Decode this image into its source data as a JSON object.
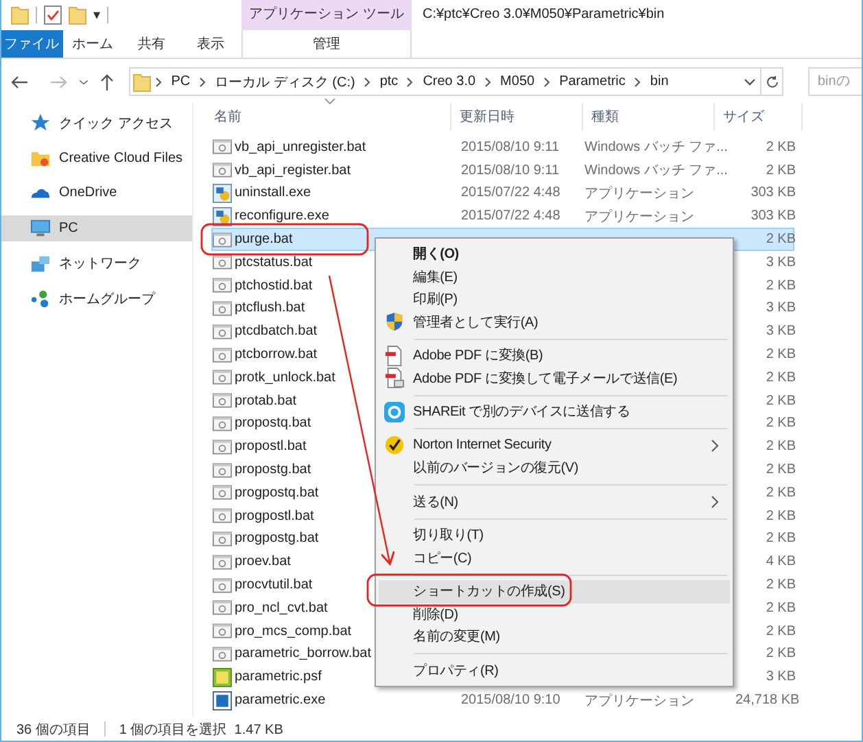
{
  "quick_toolbar": {
    "dropdown": "▾"
  },
  "title_bar": {
    "context_label": "アプリケーション ツール",
    "path": "C:¥ptc¥Creo 3.0¥M050¥Parametric¥bin"
  },
  "ribbon_tabs": [
    {
      "label": "ファイル",
      "kind": "file"
    },
    {
      "label": "ホーム",
      "kind": "normal"
    },
    {
      "label": "共有",
      "kind": "normal"
    },
    {
      "label": "表示",
      "kind": "normal"
    },
    {
      "label": "管理",
      "kind": "context"
    }
  ],
  "address_bar": {
    "crumbs": [
      "PC",
      "ローカル ディスク (C:)",
      "ptc",
      "Creo 3.0",
      "M050",
      "Parametric",
      "bin"
    ]
  },
  "search": {
    "placeholder": "binの"
  },
  "sidebar": {
    "items": [
      {
        "label": "クイック アクセス",
        "kind": "star",
        "selected": false
      },
      {
        "label": "Creative Cloud Files",
        "kind": "cloudfolder",
        "selected": false
      },
      {
        "label": "OneDrive",
        "kind": "cloud",
        "selected": false
      },
      {
        "label": "PC",
        "kind": "computer",
        "selected": true
      },
      {
        "label": "ネットワーク",
        "kind": "network",
        "selected": false
      },
      {
        "label": "ホームグループ",
        "kind": "homegroup",
        "selected": false
      }
    ]
  },
  "table": {
    "columns": [
      "名前",
      "更新日時",
      "種類",
      "サイズ"
    ],
    "rows": [
      {
        "name": "vb_api_unregister.bat",
        "date": "2015/08/10 9:11",
        "type": "Windows バッチ ファ...",
        "size": "2 KB",
        "kind": "batch",
        "selected": false
      },
      {
        "name": "vb_api_register.bat",
        "date": "2015/08/10 9:11",
        "type": "Windows バッチ ファ...",
        "size": "2 KB",
        "kind": "batch",
        "selected": false
      },
      {
        "name": "uninstall.exe",
        "date": "2015/07/22 4:48",
        "type": "アプリケーション",
        "size": "303 KB",
        "kind": "installer",
        "selected": false
      },
      {
        "name": "reconfigure.exe",
        "date": "2015/07/22 4:48",
        "type": "アプリケーション",
        "size": "303 KB",
        "kind": "installer",
        "selected": false
      },
      {
        "name": "purge.bat",
        "size": "2 KB",
        "kind": "batch",
        "selected": true
      },
      {
        "name": "ptcstatus.bat",
        "size": "3 KB",
        "kind": "batch",
        "selected": false
      },
      {
        "name": "ptchostid.bat",
        "size": "2 KB",
        "kind": "batch",
        "selected": false
      },
      {
        "name": "ptcflush.bat",
        "size": "3 KB",
        "kind": "batch",
        "selected": false
      },
      {
        "name": "ptcdbatch.bat",
        "size": "3 KB",
        "kind": "batch",
        "selected": false
      },
      {
        "name": "ptcborrow.bat",
        "size": "2 KB",
        "kind": "batch",
        "selected": false
      },
      {
        "name": "protk_unlock.bat",
        "size": "2 KB",
        "kind": "batch",
        "selected": false
      },
      {
        "name": "protab.bat",
        "size": "2 KB",
        "kind": "batch",
        "selected": false
      },
      {
        "name": "propostq.bat",
        "size": "2 KB",
        "kind": "batch",
        "selected": false
      },
      {
        "name": "propostl.bat",
        "size": "2 KB",
        "kind": "batch",
        "selected": false
      },
      {
        "name": "propostg.bat",
        "size": "2 KB",
        "kind": "batch",
        "selected": false
      },
      {
        "name": "progpostq.bat",
        "size": "2 KB",
        "kind": "batch",
        "selected": false
      },
      {
        "name": "progpostl.bat",
        "size": "2 KB",
        "kind": "batch",
        "selected": false
      },
      {
        "name": "progpostg.bat",
        "size": "2 KB",
        "kind": "batch",
        "selected": false
      },
      {
        "name": "proev.bat",
        "size": "4 KB",
        "kind": "batch",
        "selected": false
      },
      {
        "name": "procvtutil.bat",
        "size": "2 KB",
        "kind": "batch",
        "selected": false
      },
      {
        "name": "pro_ncl_cvt.bat",
        "size": "2 KB",
        "kind": "batch",
        "selected": false
      },
      {
        "name": "pro_mcs_comp.bat",
        "size": "2 KB",
        "kind": "batch",
        "selected": false
      },
      {
        "name": "parametric_borrow.bat",
        "size": "2 KB",
        "kind": "batch",
        "selected": false
      },
      {
        "name": "parametric.psf",
        "size": "3 KB",
        "kind": "settings",
        "selected": false
      },
      {
        "name": "parametric.exe",
        "date": "2015/08/10 9:10",
        "type": "アプリケーション",
        "size": "24,718 KB",
        "kind": "program",
        "selected": false
      }
    ]
  },
  "context_menu": {
    "items": [
      {
        "label": "開く(O)",
        "kind": "plain",
        "default": true,
        "submenu": false,
        "selected": false
      },
      {
        "label": "編集(E)",
        "kind": "plain",
        "default": false,
        "submenu": false,
        "selected": false
      },
      {
        "label": "印刷(P)",
        "kind": "plain",
        "default": false,
        "submenu": false,
        "selected": false
      },
      {
        "label": "管理者として実行(A)",
        "kind": "shield",
        "default": false,
        "submenu": false,
        "selected": false
      },
      {
        "kind": "separator"
      },
      {
        "label": "Adobe PDF に変換(B)",
        "kind": "pdf",
        "default": false,
        "submenu": false,
        "selected": false
      },
      {
        "label": "Adobe PDF に変換して電子メールで送信(E)",
        "kind": "pdfmail",
        "default": false,
        "submenu": false,
        "selected": false
      },
      {
        "kind": "separator"
      },
      {
        "label": "SHAREit で別のデバイスに送信する",
        "kind": "share",
        "default": false,
        "submenu": false,
        "selected": false
      },
      {
        "kind": "separator"
      },
      {
        "label": "Norton Internet Security",
        "kind": "norton",
        "default": false,
        "submenu": true,
        "selected": false
      },
      {
        "label": "以前のバージョンの復元(V)",
        "kind": "plain",
        "default": false,
        "submenu": false,
        "selected": false
      },
      {
        "kind": "separator"
      },
      {
        "label": "送る(N)",
        "kind": "plain",
        "default": false,
        "submenu": true,
        "selected": false
      },
      {
        "kind": "separator"
      },
      {
        "label": "切り取り(T)",
        "kind": "plain",
        "default": false,
        "submenu": false,
        "selected": false
      },
      {
        "label": "コピー(C)",
        "kind": "plain",
        "default": false,
        "submenu": false,
        "selected": false
      },
      {
        "kind": "separator"
      },
      {
        "label": "ショートカットの作成(S)",
        "kind": "plain",
        "default": false,
        "submenu": false,
        "selected": true
      },
      {
        "label": "削除(D)",
        "kind": "plain",
        "default": false,
        "submenu": false,
        "selected": false
      },
      {
        "label": "名前の変更(M)",
        "kind": "plain",
        "default": false,
        "submenu": false,
        "selected": false
      },
      {
        "kind": "separator"
      },
      {
        "label": "プロパティ(R)",
        "kind": "plain",
        "default": false,
        "submenu": false,
        "selected": false
      }
    ]
  },
  "status_bar": {
    "item_count": "36 個の項目",
    "selection": "1 個の項目を選択  1.47 KB"
  }
}
